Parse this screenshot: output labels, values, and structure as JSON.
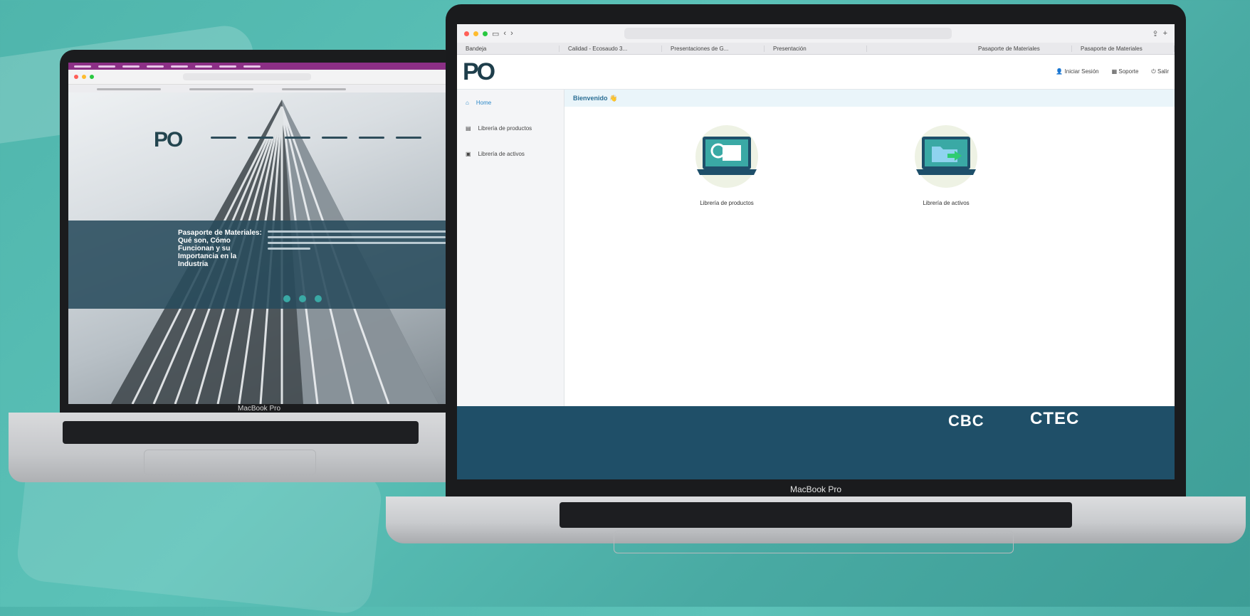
{
  "left_laptop": {
    "brand": "MacBook Pro",
    "banner_title": "Pasaporte de Materiales: Qué son, Cómo Funcionan y su Importancia en la Industria"
  },
  "right_laptop": {
    "brand": "MacBook Pro",
    "url": "",
    "tabs": [
      "Bandeja",
      "Calidad - Ecosaudo 3...",
      "Presentaciones de G...",
      "Presentación",
      "",
      "Pasaporte de Materiales",
      "Pasaporte de Materiales"
    ],
    "header_links": [
      "Iniciar Sesión",
      "Soporte",
      "Salir"
    ],
    "sidebar": [
      {
        "label": "Home",
        "icon": "home-icon"
      },
      {
        "label": "Librería de productos",
        "icon": "book-icon"
      },
      {
        "label": "Librería de activos",
        "icon": "calendar-icon"
      }
    ],
    "welcome": "Bienvenido",
    "cards": [
      {
        "label": "Librería de productos",
        "icon": "laptop-search-icon"
      },
      {
        "label": "Librería de activos",
        "icon": "laptop-folder-icon"
      }
    ],
    "footer": {
      "logo1": "CBC",
      "logo2": "CTEC"
    }
  },
  "colors": {
    "background": "#4fb5ac",
    "accent": "#2b88c8",
    "footer": "#1f4f68",
    "banner": "#284b5c"
  }
}
